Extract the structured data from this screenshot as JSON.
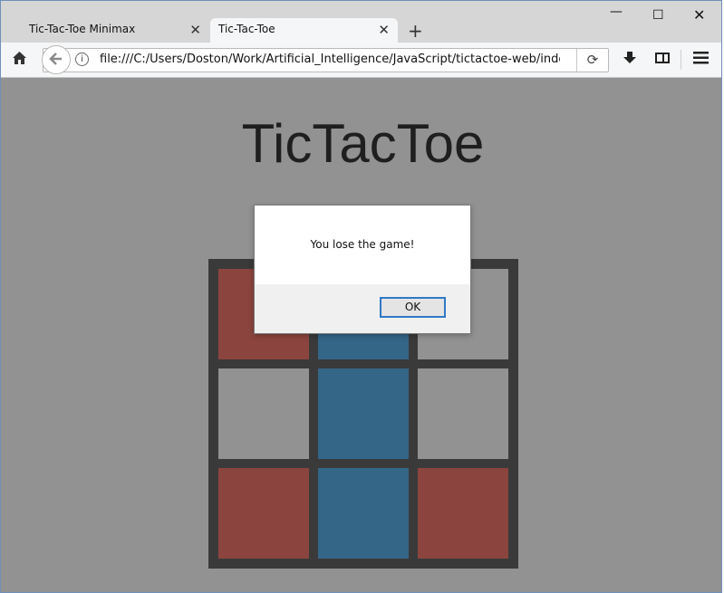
{
  "browser": {
    "tabs": [
      {
        "label": "Tic-Tac-Toe Minimax",
        "close": "✕"
      },
      {
        "label": "Tic-Tac-Toe",
        "close": "✕"
      }
    ],
    "new_tab": "+",
    "window_controls": {
      "minimize": "—",
      "maximize": "☐",
      "close": "✕"
    },
    "url": "file:///C:/Users/Doston/Work/Artificial_Intelligence/JavaScript/tictactoe-web/index.h",
    "icons": {
      "home": "home-icon",
      "back": "back-arrow-icon",
      "info": "info-icon",
      "reload": "reload-icon",
      "download": "download-icon",
      "sidebar": "sidebar-icon",
      "menu": "hamburger-menu-icon"
    }
  },
  "page": {
    "title": "TicTacToe",
    "board": {
      "cells": [
        "red",
        "blue",
        "empty",
        "empty",
        "blue",
        "empty",
        "red",
        "blue",
        "red"
      ],
      "colors": {
        "red": "#8b453e",
        "blue": "#346688",
        "empty": "#929292",
        "grid": "#3a3a3a"
      }
    }
  },
  "dialog": {
    "message": "You lose the game!",
    "ok_label": "OK"
  }
}
